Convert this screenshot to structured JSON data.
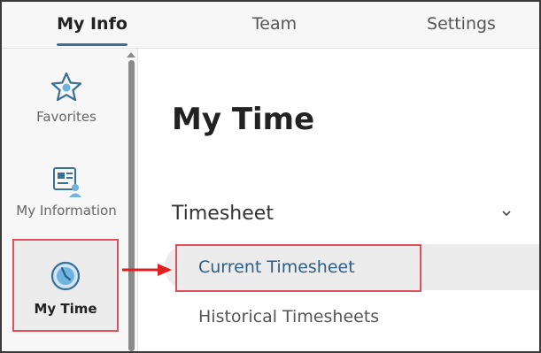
{
  "tabs": [
    {
      "label": "My Info",
      "active": true
    },
    {
      "label": "Team",
      "active": false
    },
    {
      "label": "Settings",
      "active": false
    }
  ],
  "sidebar": {
    "items": [
      {
        "label": "Favorites",
        "icon": "star-icon"
      },
      {
        "label": "My Information",
        "icon": "id-card-icon"
      },
      {
        "label": "My Time",
        "icon": "clock-icon",
        "active": true
      }
    ]
  },
  "main": {
    "title": "My Time",
    "section": {
      "label": "Timesheet",
      "expanded": true,
      "links": [
        {
          "label": "Current Timesheet",
          "selected": true
        },
        {
          "label": "Historical Timesheets",
          "selected": false
        }
      ]
    }
  },
  "colors": {
    "accent": "#3a6f96",
    "highlight_outline": "#e0505a",
    "arrow": "#e02020",
    "link_selected": "#2e5d86"
  }
}
